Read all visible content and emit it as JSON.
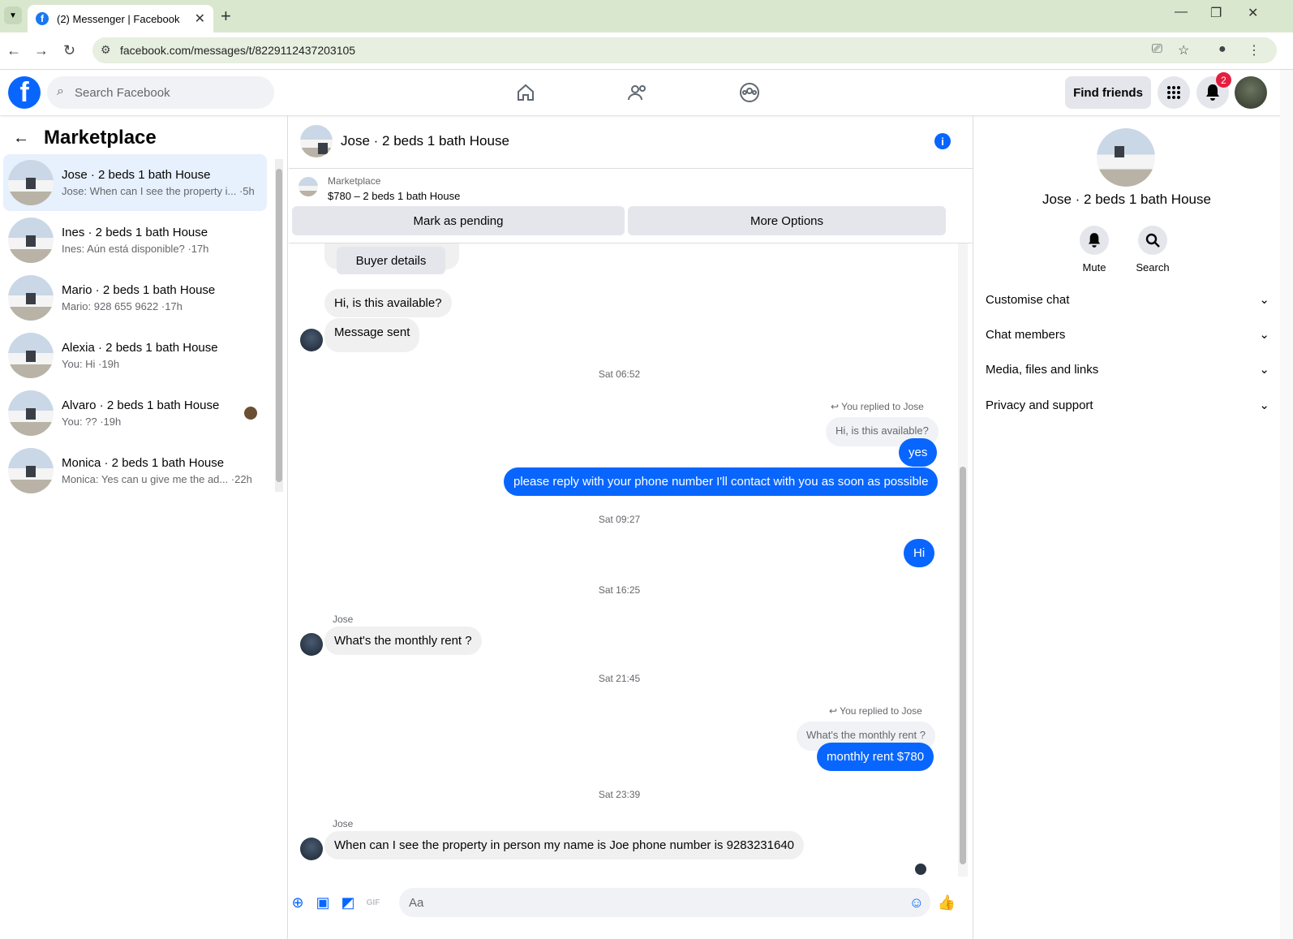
{
  "browser": {
    "tab_title": "(2) Messenger | Facebook",
    "url": "facebook.com/messages/t/8229112437203105"
  },
  "fb": {
    "search_placeholder": "Search Facebook",
    "find_friends": "Find friends",
    "notif_count": "2"
  },
  "sidebar": {
    "title": "Marketplace",
    "items": [
      {
        "name": "Jose · 2 beds 1 bath House",
        "preview": "Jose: When can I see the property i... ·5h"
      },
      {
        "name": "Ines · 2 beds 1 bath House",
        "preview": "Ines: Aún está disponible? ·17h"
      },
      {
        "name": "Mario · 2 beds 1 bath House",
        "preview": "Mario: 928 655 9622 ·17h"
      },
      {
        "name": "Alexia · 2 beds 1 bath House",
        "preview": "You: Hi ·19h"
      },
      {
        "name": "Alvaro · 2 beds 1 bath House",
        "preview": "You: ?? ·19h"
      },
      {
        "name": "Monica · 2 beds 1 bath House",
        "preview": "Monica: Yes can u give me the ad... ·22h"
      }
    ]
  },
  "chat": {
    "title": "Jose · 2 beds 1 bath House",
    "marketplace_label": "Marketplace",
    "listing": "$780 – 2 beds 1 bath House",
    "mark_pending": "Mark as pending",
    "more_options": "More Options",
    "buyer_details": "Buyer details",
    "m1": "Hi, is this available?",
    "m2": "Message sent",
    "ts1": "Sat 06:52",
    "replied": "You replied to Jose",
    "q1": "Hi, is this available?",
    "m3": "yes",
    "m4": "please reply with your phone number  I'll contact with you as soon as possible",
    "ts2": "Sat 09:27",
    "m5": "Hi",
    "ts3": "Sat 16:25",
    "sender": "Jose",
    "m6": "What's the monthly rent ?",
    "ts4": "Sat 21:45",
    "q2": "What's the monthly rent ?",
    "m7": "monthly rent $780",
    "ts5": "Sat 23:39",
    "m8": "When can I see the property in person my name is Joe phone number is 9283231640",
    "input_placeholder": "Aa"
  },
  "details": {
    "name": "Jose · 2 beds 1 bath House",
    "mute": "Mute",
    "search": "Search",
    "sections": [
      "Customise chat",
      "Chat members",
      "Media, files and links",
      "Privacy and support"
    ]
  },
  "colors": {
    "brand": "#0866ff",
    "tabbar": "#d9e7cf"
  }
}
